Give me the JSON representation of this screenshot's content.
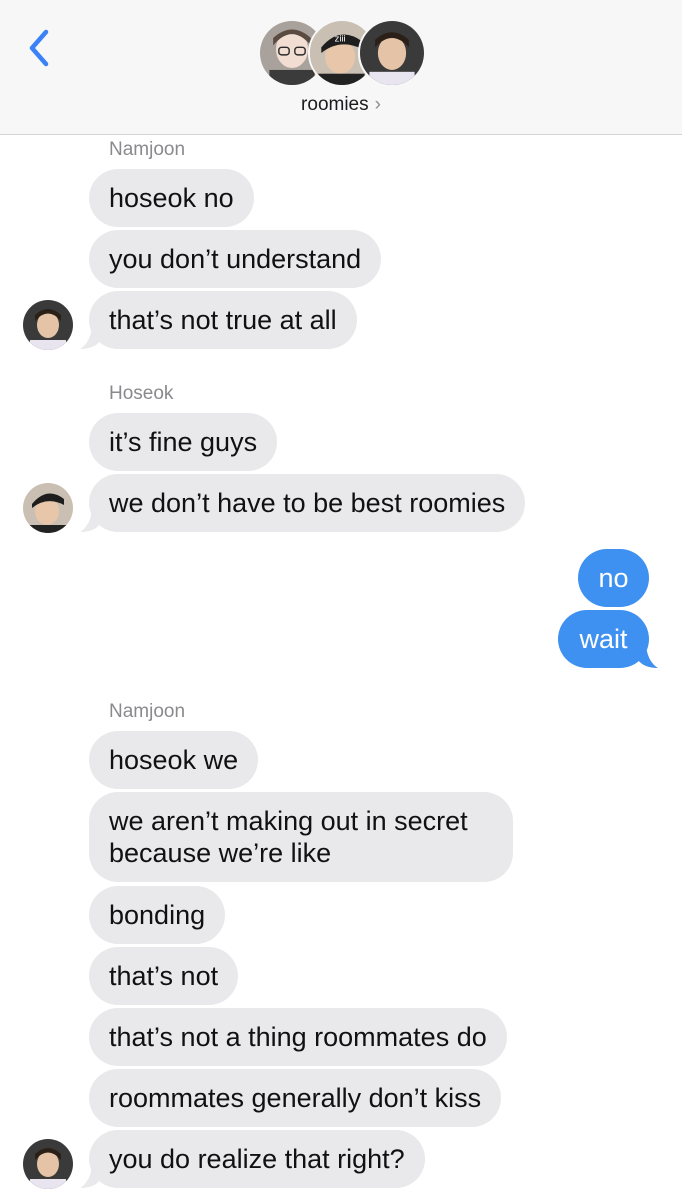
{
  "header": {
    "group_name": "roomies",
    "chevron": "›",
    "back_icon": "chevron-left-icon",
    "accent": "#3a82f6"
  },
  "colors": {
    "incoming_bubble": "#e9e9eb",
    "outgoing_bubble": "#3e91f0",
    "sender_label": "#8a8a8e"
  },
  "messages": {
    "group1": {
      "sender": "Namjoon",
      "texts": [
        "hoseok no",
        "you don’t understand",
        "that’s not true at all"
      ]
    },
    "group2": {
      "sender": "Hoseok",
      "texts": [
        "it’s fine guys",
        "we don’t have to be best roomies"
      ]
    },
    "outgoing": {
      "texts": [
        "no",
        "wait"
      ]
    },
    "group3": {
      "sender": "Namjoon",
      "texts": [
        "hoseok we",
        "we aren’t making out in secret because we’re like",
        "bonding",
        "that’s not",
        "that’s not a thing roommates do",
        "roommates generally don’t kiss",
        "you do realize that right?"
      ]
    }
  }
}
